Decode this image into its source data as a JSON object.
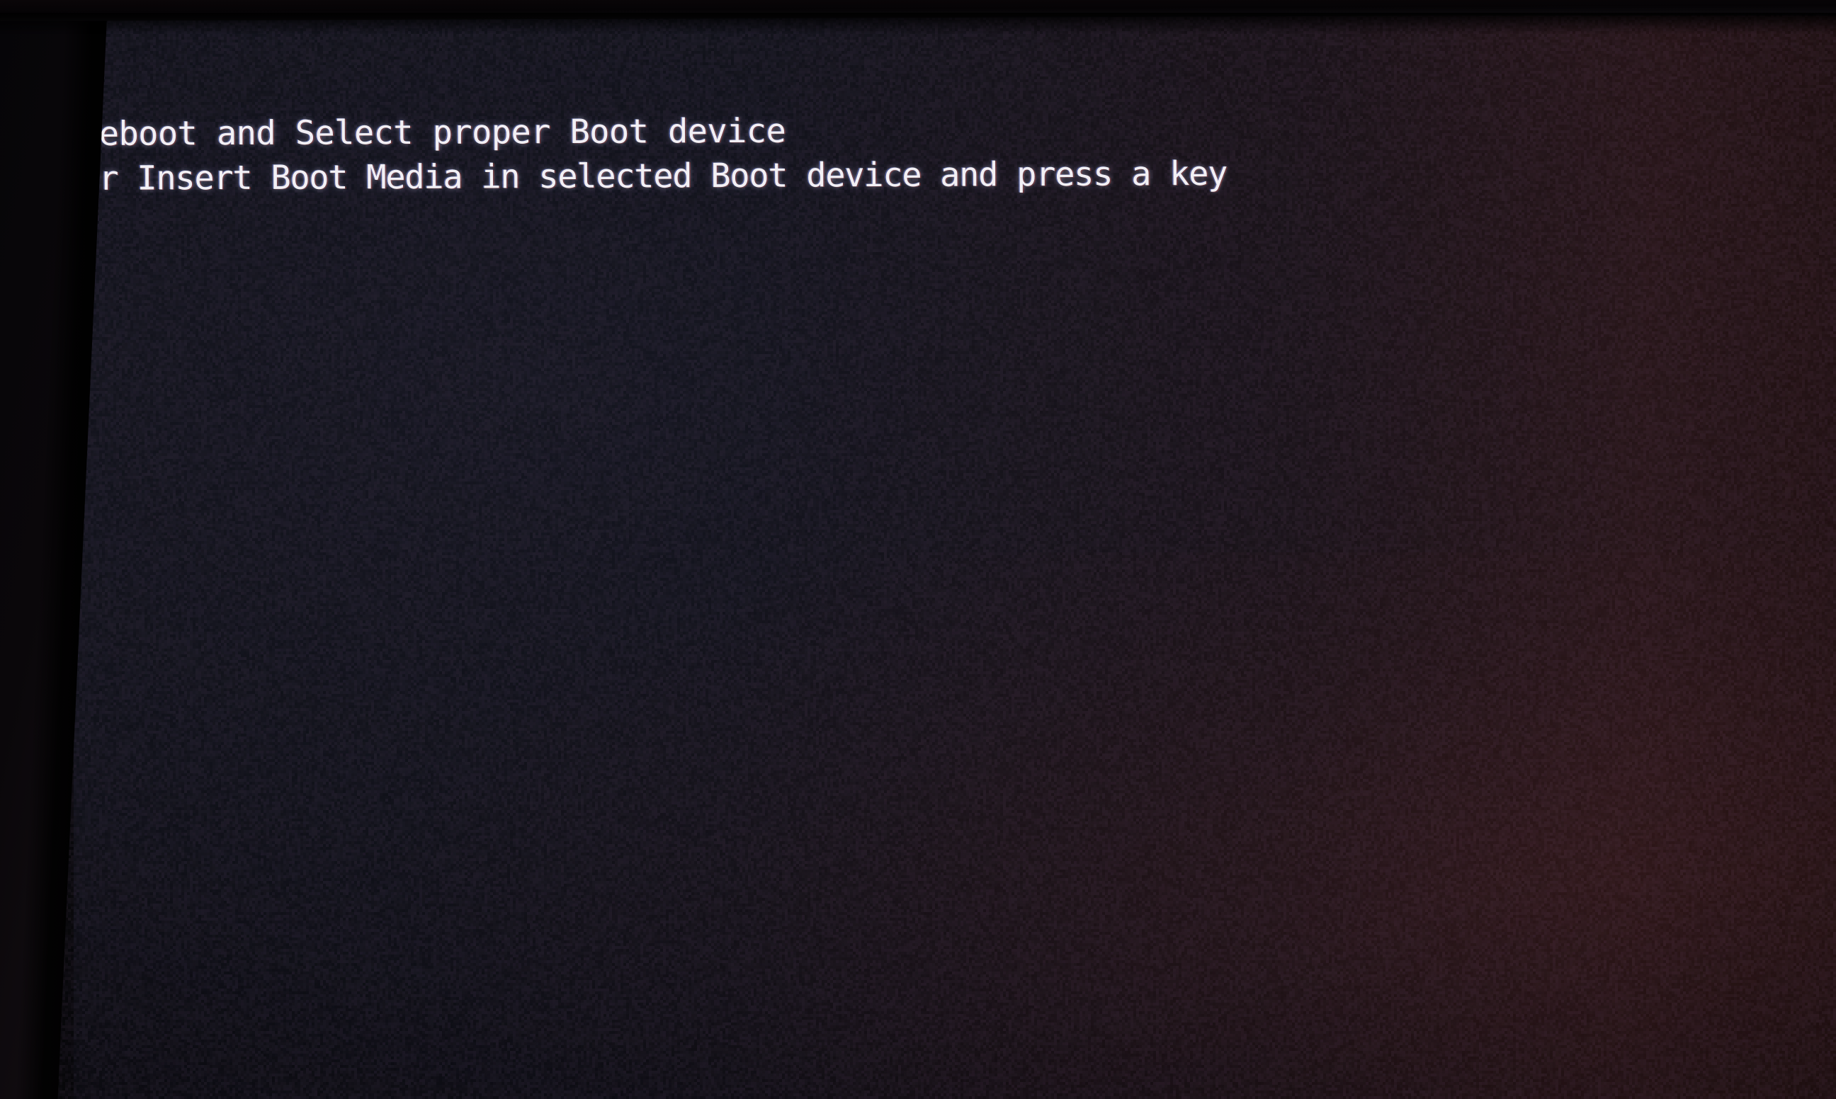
{
  "screen": {
    "kind": "bios-boot-error-screen",
    "device_label": "photographed-monitor",
    "background_color": "#0d0d14",
    "text_color": "#f2f0f4",
    "bezel_color": "#070509",
    "warm_edge_color": "#2e1618"
  },
  "console": {
    "lines": [
      "Reboot and Select proper Boot device",
      "or Insert Boot Media in selected Boot device and press a key"
    ],
    "line_1": "Reboot and Select proper Boot device",
    "line_2": "or Insert Boot Media in selected Boot device and press a key"
  }
}
